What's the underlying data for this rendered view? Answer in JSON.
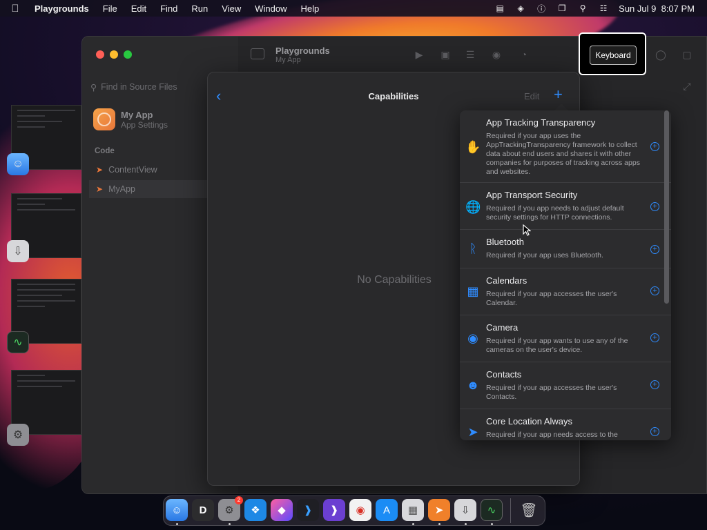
{
  "menubar": {
    "app_name": "Playgrounds",
    "menus": [
      "File",
      "Edit",
      "Find",
      "Run",
      "View",
      "Window",
      "Help"
    ],
    "clock": "Sun Jul 9  8:07 PM",
    "icons": [
      "display-icon",
      "layers-icon",
      "info-circle-icon",
      "window-icon",
      "search-icon",
      "control-center-icon"
    ]
  },
  "window": {
    "title": "Playgrounds",
    "subtitle": "My App",
    "search_placeholder": "Find in Source Files",
    "app": {
      "name": "My App",
      "subtitle": "App Settings"
    },
    "section": "Code",
    "files": [
      "ContentView",
      "MyApp"
    ]
  },
  "sheet": {
    "title": "Capabilities",
    "edit_label": "Edit",
    "empty_text": "No Capabilities"
  },
  "capabilities": [
    {
      "name": "App Tracking Transparency",
      "desc": "Required if your app uses the AppTrackingTransparency framework to collect data about end users and shares it with other companies for purposes of tracking across apps and websites.",
      "icon": "hand-icon"
    },
    {
      "name": "App Transport Security",
      "desc": "Required if you app needs to adjust default security settings for HTTP connections.",
      "icon": "globe-lock-icon"
    },
    {
      "name": "Bluetooth",
      "desc": "Required if your app uses Bluetooth.",
      "icon": "bluetooth-icon"
    },
    {
      "name": "Calendars",
      "desc": "Required if your app accesses the user's Calendar.",
      "icon": "calendar-icon"
    },
    {
      "name": "Camera",
      "desc": "Required if your app wants to use any of the cameras on the user's device.",
      "icon": "camera-icon"
    },
    {
      "name": "Contacts",
      "desc": "Required if your app accesses the user's Contacts.",
      "icon": "contact-icon"
    },
    {
      "name": "Core Location Always",
      "desc": "Required if your app needs access to the",
      "icon": "location-arrow-icon"
    }
  ],
  "keyboard_label": "Keyboard",
  "dock": {
    "settings_badge": "2",
    "apps": [
      "finder-icon",
      "d-app-icon",
      "system-settings-icon",
      "safari-icon",
      "shortcuts-icon",
      "vscode-icon",
      "visual-studio-icon",
      "chrome-icon",
      "app-store-icon",
      "launchpad-icon",
      "swift-playgrounds-icon",
      "installer-icon",
      "activity-monitor-icon",
      "trash-icon"
    ]
  },
  "colors": {
    "accent": "#2f8cff",
    "sheet_bg": "#29292b",
    "popover_bg": "#2c2c2e"
  }
}
